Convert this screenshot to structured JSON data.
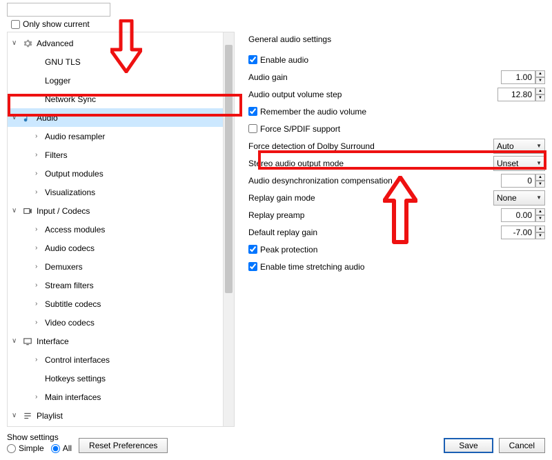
{
  "top": {
    "only_show_current": "Only show current"
  },
  "tree": {
    "advanced": "Advanced",
    "gnu_tls": "GNU TLS",
    "logger": "Logger",
    "network_sync": "Network Sync",
    "audio": "Audio",
    "audio_resampler": "Audio resampler",
    "filters": "Filters",
    "output_modules": "Output modules",
    "visualizations": "Visualizations",
    "input_codecs": "Input / Codecs",
    "access_modules": "Access modules",
    "audio_codecs": "Audio codecs",
    "demuxers": "Demuxers",
    "stream_filters": "Stream filters",
    "subtitle_codecs": "Subtitle codecs",
    "video_codecs": "Video codecs",
    "interface": "Interface",
    "control_interfaces": "Control interfaces",
    "hotkeys_settings": "Hotkeys settings",
    "main_interfaces": "Main interfaces",
    "playlist": "Playlist"
  },
  "settings": {
    "section": "General audio settings",
    "enable_audio": "Enable audio",
    "audio_gain": "Audio gain",
    "audio_gain_val": "1.00",
    "output_step": "Audio output volume step",
    "output_step_val": "12.80",
    "remember_volume": "Remember the audio volume",
    "force_spdif": "Force S/PDIF support",
    "dolby": "Force detection of Dolby Surround",
    "dolby_val": "Auto",
    "stereo_mode": "Stereo audio output mode",
    "stereo_mode_val": "Unset",
    "desync": "Audio desynchronization compensation",
    "desync_val": "0",
    "replay_gain_mode": "Replay gain mode",
    "replay_gain_mode_val": "None",
    "replay_preamp": "Replay preamp",
    "replay_preamp_val": "0.00",
    "default_replay_gain": "Default replay gain",
    "default_replay_gain_val": "-7.00",
    "peak_protection": "Peak protection",
    "time_stretch": "Enable time stretching audio"
  },
  "bottom": {
    "show_settings": "Show settings",
    "simple": "Simple",
    "all": "All",
    "reset": "Reset Preferences",
    "save": "Save",
    "cancel": "Cancel"
  }
}
